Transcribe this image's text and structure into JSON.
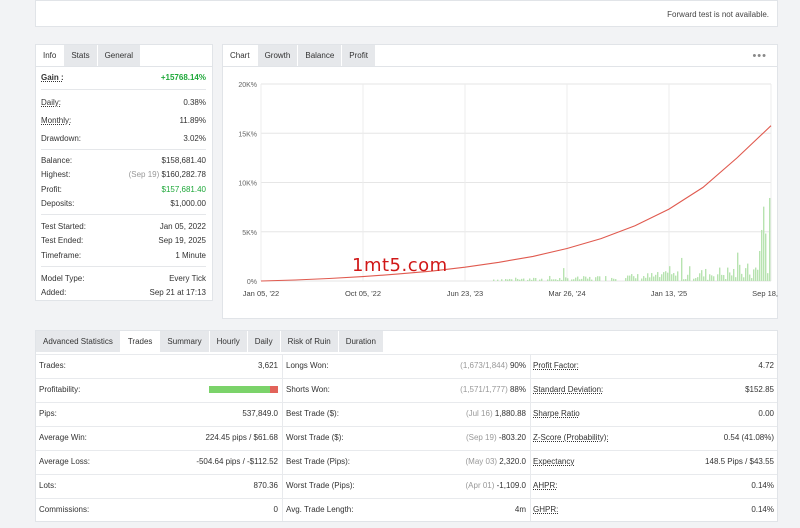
{
  "top": {
    "forward_msg": "Forward test is not available."
  },
  "left_tabs": [
    "Info",
    "Stats",
    "General"
  ],
  "stats": {
    "gain": {
      "label": "Gain :",
      "value": "+15768.14%"
    },
    "daily": {
      "label": "Daily:",
      "value": "0.38%"
    },
    "monthly": {
      "label": "Monthly:",
      "value": "11.89%"
    },
    "drawdown": {
      "label": "Drawdown:",
      "value": "3.02%"
    },
    "balance": {
      "label": "Balance:",
      "value": "$158,681.40"
    },
    "highest": {
      "label": "Highest:",
      "note": "(Sep 19)",
      "value": "$160,282.78"
    },
    "profit": {
      "label": "Profit:",
      "value": "$157,681.40"
    },
    "deposits": {
      "label": "Deposits:",
      "value": "$1,000.00"
    },
    "test_started": {
      "label": "Test Started:",
      "value": "Jan 05, 2022"
    },
    "test_ended": {
      "label": "Test Ended:",
      "value": "Sep 19, 2025"
    },
    "timeframe": {
      "label": "Timeframe:",
      "value": "1 Minute"
    },
    "model_type": {
      "label": "Model Type:",
      "value": "Every Tick"
    },
    "added": {
      "label": "Added:",
      "value": "Sep 21 at 17:13"
    }
  },
  "chart_tabs": [
    "Chart",
    "Growth",
    "Balance",
    "Profit"
  ],
  "chart_menu": "•••",
  "watermark": "1mt5.com",
  "chart_data": {
    "type": "line",
    "y_ticks": [
      "20K%",
      "15K%",
      "10K%",
      "5K%",
      "0%"
    ],
    "x_ticks": [
      "Jan 05, '22",
      "Oct 05, '22",
      "Jun 23, '23",
      "Mar 26, '24",
      "Jan 13, '25",
      "Sep 18, '25"
    ],
    "ylim": [
      0,
      20000
    ],
    "series": [
      {
        "values": [
          0,
          100,
          250,
          450,
          700,
          1000,
          1400,
          1900,
          2500,
          3300,
          4300,
          5600,
          7300,
          9500,
          12500,
          15768
        ]
      }
    ],
    "colors": {
      "line": "#e05a4f",
      "bars": "#b7e3b0"
    }
  },
  "adv_tabs": [
    "Advanced Statistics",
    "Trades",
    "Summary",
    "Hourly",
    "Daily",
    "Risk of Ruin",
    "Duration"
  ],
  "adv_rows": [
    {
      "c1l": "Trades:",
      "c1v": "3,621",
      "c2l": "Longs Won:",
      "c2n": "(1,673/1,844)",
      "c2v": "90%",
      "c3l": "Profit Factor:",
      "c3v": "4.72"
    },
    {
      "c1l": "Profitability:",
      "c1v": "",
      "c2l": "Shorts Won:",
      "c2n": "(1,571/1,777)",
      "c2v": "88%",
      "c3l": "Standard Deviation:",
      "c3v": "$152.85"
    },
    {
      "c1l": "Pips:",
      "c1v": "537,849.0",
      "c2l": "Best Trade ($):",
      "c2n": "(Jul 16)",
      "c2v": "1,880.88",
      "c3l": "Sharpe Ratio",
      "c3v": "0.00"
    },
    {
      "c1l": "Average Win:",
      "c1v": "224.45 pips / $61.68",
      "c2l": "Worst Trade ($):",
      "c2n": "(Sep 19)",
      "c2v": "-803.20",
      "c3l": "Z-Score (Probability):",
      "c3v": "0.54 (41.08%)"
    },
    {
      "c1l": "Average Loss:",
      "c1v": "-504.64 pips / -$112.52",
      "c2l": "Best Trade (Pips):",
      "c2n": "(May 03)",
      "c2v": "2,320.0",
      "c3l": "Expectancy",
      "c3v": "148.5 Pips / $43.55"
    },
    {
      "c1l": "Lots:",
      "c1v": "870.36",
      "c2l": "Worst Trade (Pips):",
      "c2n": "(Apr 01)",
      "c2v": "-1,109.0",
      "c3l": "AHPR:",
      "c3v": "0.14%"
    },
    {
      "c1l": "Commissions:",
      "c1v": "0",
      "c2l": "Avg. Trade Length:",
      "c2n": "",
      "c2v": "4m",
      "c3l": "GHPR:",
      "c3v": "0.14%"
    }
  ],
  "profitability_bar": {
    "win_fraction": 0.89,
    "win_color": "#7bd36a",
    "loss_color": "#e2635a"
  }
}
